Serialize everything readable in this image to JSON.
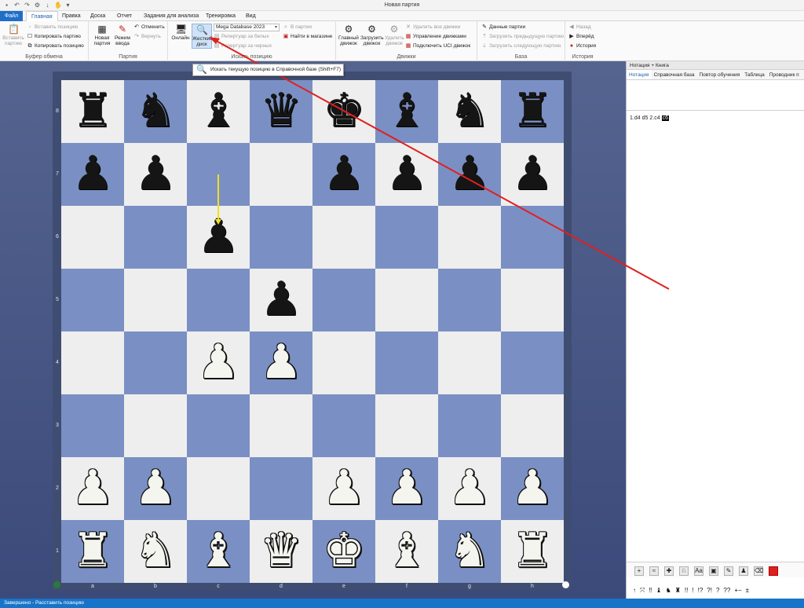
{
  "window": {
    "title": "Новая партия"
  },
  "quick_access": [
    "save-icon",
    "undo-icon",
    "redo-icon",
    "settings-icon",
    "arrow-icon",
    "hand-icon",
    "dropdown-icon"
  ],
  "menu_tabs": {
    "file": "Файл",
    "home": "Главная",
    "edit": "Правка",
    "board": "Доска",
    "report": "Отчет",
    "analysis": "Задания для анализа",
    "training": "Тренировка",
    "view": "Вид"
  },
  "ribbon": {
    "clipboard": {
      "label": "Буфер обмена",
      "paste_game": "Вставить партию",
      "paste_position": "Вставить позицию",
      "copy_game": "Копировать партию",
      "copy_position": "Копировать позицию"
    },
    "game": {
      "label": "Партия",
      "new_game": "Новая партия",
      "input_mode": "Режим ввода",
      "undo": "Отменить",
      "redo": "Вернуть"
    },
    "search": {
      "label": "Искать позицию",
      "online": "Онлайн",
      "hard_disk": "Жесткий диск",
      "database": "Mega Database 2023",
      "in_games": "В партии",
      "rep_white": "Репертуар за белых",
      "rep_black": "Репертуар за черных",
      "find_in_shop": "Найти в магазине"
    },
    "engines": {
      "label": "Движки",
      "main_engine": "Главный движок",
      "load_engine": "Загрузить движок",
      "remove_engine": "Удалить движок",
      "remove_all": "Удалить все движки",
      "manage": "Управление движками",
      "connect_uci": "Подключить UCI движок"
    },
    "base": {
      "label": "База",
      "game_data": "Данные партии",
      "load_prev": "Загрузить предыдущую партию",
      "load_next": "Загрузить следующую партию"
    },
    "history": {
      "label": "История",
      "back": "Назад",
      "forward": "Вперёд",
      "history": "История"
    }
  },
  "tooltip": {
    "text": "Искать текущую позицию в Справочной базе (Shift+F7)"
  },
  "board": {
    "files": [
      "a",
      "b",
      "c",
      "d",
      "e",
      "f",
      "g",
      "h"
    ],
    "ranks": [
      "8",
      "7",
      "6",
      "5",
      "4",
      "3",
      "2",
      "1"
    ],
    "rows": [
      [
        "r",
        "n",
        "b",
        "q",
        "k",
        "b",
        "n",
        "r"
      ],
      [
        "p",
        "p",
        "",
        "",
        "p",
        "p",
        "p",
        "p"
      ],
      [
        "",
        "",
        "p",
        "",
        "",
        "",
        "",
        ""
      ],
      [
        "",
        "",
        "",
        "p",
        "",
        "",
        "",
        ""
      ],
      [
        "",
        "",
        "P",
        "P",
        "",
        "",
        "",
        ""
      ],
      [
        "",
        "",
        "",
        "",
        "",
        "",
        "",
        ""
      ],
      [
        "P",
        "P",
        "",
        "",
        "P",
        "P",
        "P",
        "P"
      ],
      [
        "R",
        "N",
        "B",
        "Q",
        "K",
        "B",
        "N",
        "R"
      ]
    ],
    "last_move": {
      "from": "c7",
      "to": "c6"
    },
    "colors": {
      "light": "#eeeeee",
      "dark": "#7a90c4",
      "last_move_arrow": "#f0e020",
      "annotation_arrow": "#e02020"
    }
  },
  "right_panel": {
    "title": "Нотация + Книга",
    "tabs": [
      "Нотация",
      "Справочная база",
      "Повтор обучения",
      "Таблица",
      "Проводник п"
    ],
    "moves": [
      "1.d4",
      "d5",
      "2.c4",
      "c6"
    ],
    "toolbar_icons": [
      "plus-icon",
      "variation-icon",
      "move-icon",
      "eval-icon",
      "text-icon",
      "diagram-icon",
      "edit-icon",
      "pieces-icon",
      "eraser-icon",
      "color-square-icon"
    ],
    "symbols": [
      "↑",
      "⤧",
      "‼",
      "♝",
      "♞",
      "♜",
      "!!",
      "!",
      "!?",
      "?!",
      "?",
      "??",
      "+−",
      "±"
    ]
  },
  "status": {
    "text": "Завершено - Расставить позицию"
  }
}
